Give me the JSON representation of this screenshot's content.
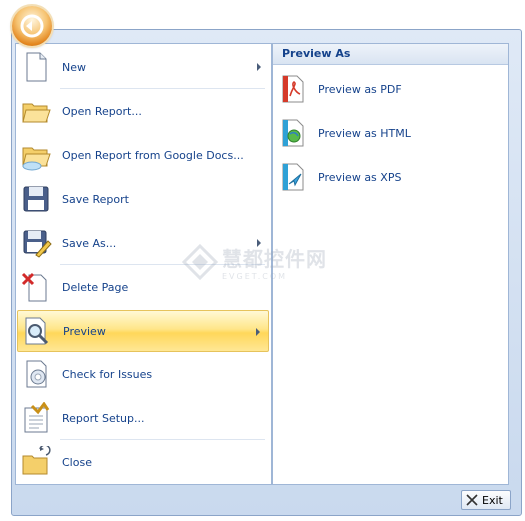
{
  "menu": {
    "items": [
      {
        "label": "New",
        "icon": "new-page-icon",
        "has_submenu": true
      },
      {
        "label": "Open Report...",
        "icon": "open-folder-icon",
        "has_submenu": false
      },
      {
        "label": "Open Report from Google Docs...",
        "icon": "cloud-folder-icon",
        "has_submenu": false
      },
      {
        "label": "Save Report",
        "icon": "floppy-disk-icon",
        "has_submenu": false
      },
      {
        "label": "Save As...",
        "icon": "save-as-icon",
        "has_submenu": true
      },
      {
        "label": "Delete Page",
        "icon": "delete-page-icon",
        "has_submenu": false
      },
      {
        "label": "Preview",
        "icon": "preview-magnifier-icon",
        "has_submenu": true,
        "selected": true
      },
      {
        "label": "Check for Issues",
        "icon": "check-issues-icon",
        "has_submenu": false
      },
      {
        "label": "Report Setup...",
        "icon": "report-setup-icon",
        "has_submenu": false
      },
      {
        "label": "Close",
        "icon": "close-folder-icon",
        "has_submenu": false
      }
    ]
  },
  "submenu": {
    "title": "Preview As",
    "items": [
      {
        "label": "Preview as PDF",
        "icon": "pdf-icon"
      },
      {
        "label": "Preview as HTML",
        "icon": "html-icon"
      },
      {
        "label": "Preview as XPS",
        "icon": "xps-icon"
      }
    ]
  },
  "watermark": {
    "line1": "慧都控件网",
    "line2": "EVGET.COM"
  },
  "footer": {
    "exit_label": "Exit"
  },
  "colors": {
    "text": "#15428b",
    "selected_highlight": "#ffd75a",
    "frame": "#c9d9ee"
  }
}
